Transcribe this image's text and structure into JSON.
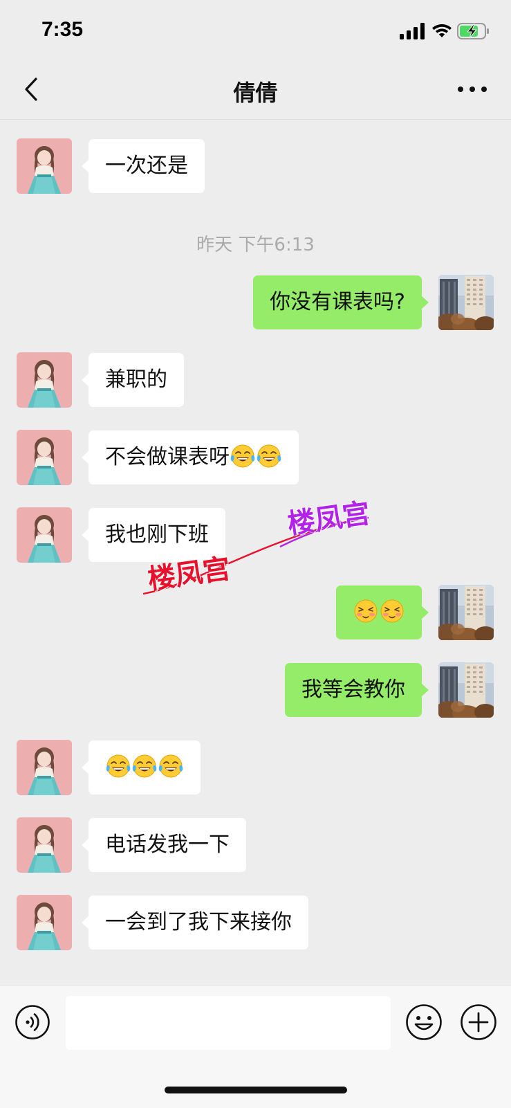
{
  "status_bar": {
    "time": "7:35"
  },
  "nav": {
    "title": "倩倩",
    "back_icon": "chevron-left-icon",
    "more_icon": "more-dots-icon"
  },
  "chat": {
    "timestamp": "昨天 下午6:13",
    "messages": [
      {
        "side": "left",
        "text": "一次还是",
        "emoji": []
      },
      {
        "side": "right",
        "text": "你没有课表吗?",
        "emoji": []
      },
      {
        "side": "left",
        "text": "兼职的",
        "emoji": []
      },
      {
        "side": "left",
        "text": "不会做课表呀",
        "emoji": [
          "tears-of-joy",
          "tears-of-joy"
        ]
      },
      {
        "side": "left",
        "text": "我也刚下班",
        "emoji": []
      },
      {
        "side": "right",
        "text": "",
        "emoji": [
          "blushing-face",
          "blushing-face"
        ]
      },
      {
        "side": "right",
        "text": "我等会教你",
        "emoji": []
      },
      {
        "side": "left",
        "text": "",
        "emoji": [
          "tears-of-joy",
          "tears-of-joy",
          "tears-of-joy"
        ]
      },
      {
        "side": "left",
        "text": "电话发我一下",
        "emoji": []
      },
      {
        "side": "left",
        "text": "一会到了我下来接你",
        "emoji": []
      }
    ]
  },
  "watermark": {
    "text_1": "楼凤宫",
    "text_2": "楼凤宫"
  },
  "input_bar": {
    "voice_icon": "voice-icon",
    "emoji_icon": "emoji-smile-icon",
    "plus_icon": "plus-circle-icon",
    "input_value": ""
  },
  "colors": {
    "background": "#ededed",
    "sent_bubble": "#95ec69",
    "received_bubble": "#ffffff",
    "timestamp": "#ababab"
  }
}
